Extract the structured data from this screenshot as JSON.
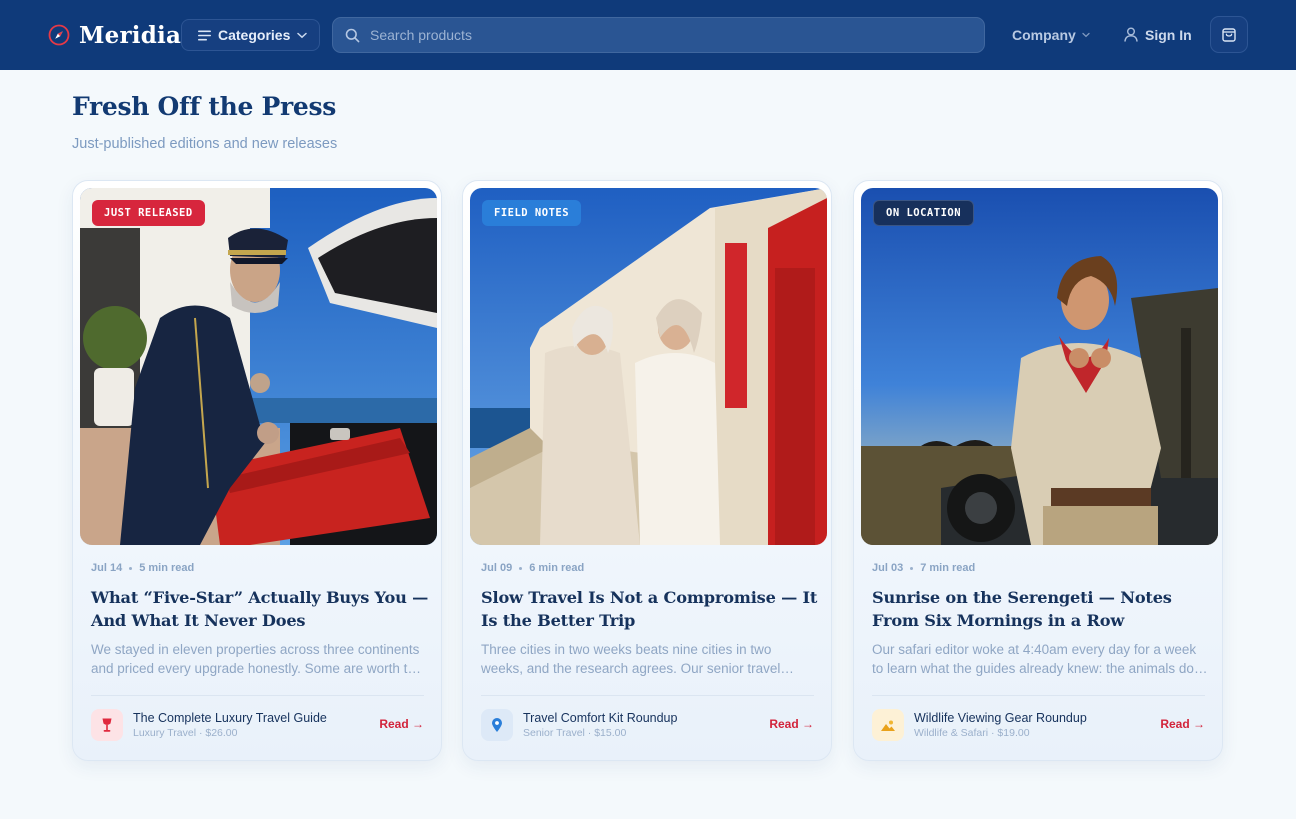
{
  "header": {
    "brand": "Meridian",
    "categories_label": "Categories",
    "search_placeholder": "Search products",
    "company_label": "Company",
    "signin_label": "Sign In"
  },
  "section": {
    "title": "Fresh Off the Press",
    "subtitle": "Just-published editions and new releases"
  },
  "colors": {
    "header_bg": "#0f3a7a",
    "accent_red": "#d7263d",
    "accent_blue": "#2a7ed9",
    "badge_navy": "#17305c"
  },
  "cards": [
    {
      "badge": "JUST RELEASED",
      "date": "Jul 14",
      "read_time": "5 min read",
      "title": "What “Five-Star” Actually Buys You — And What It Never Does",
      "excerpt": "We stayed in eleven properties across three continents and priced every upgrade honestly. Some are worth the money, most are not.",
      "product_name": "The Complete Luxury Travel Guide",
      "product_meta": "Luxury Travel · $26.00",
      "product_icon": "wine-glass-icon",
      "cta": "Read →"
    },
    {
      "badge": "FIELD NOTES",
      "date": "Jul 09",
      "read_time": "6 min read",
      "title": "Slow Travel Is Not a Compromise — It Is the Better Trip",
      "excerpt": "Three cities in two weeks beats nine cities in two weeks, and the research agrees. Our senior travel editors explain why.",
      "product_name": "Travel Comfort Kit Roundup",
      "product_meta": "Senior Travel · $15.00",
      "product_icon": "map-pin-icon",
      "cta": "Read →"
    },
    {
      "badge": "ON LOCATION",
      "date": "Jul 03",
      "read_time": "7 min read",
      "title": "Sunrise on the Serengeti — Notes From Six Mornings in a Row",
      "excerpt": "Our safari editor woke at 4:40am every day for a week to learn what the guides already knew: the animals do not wait.",
      "product_name": "Wildlife Viewing Gear Roundup",
      "product_meta": "Wildlife & Safari · $19.00",
      "product_icon": "landscape-icon",
      "cta": "Read →"
    }
  ]
}
